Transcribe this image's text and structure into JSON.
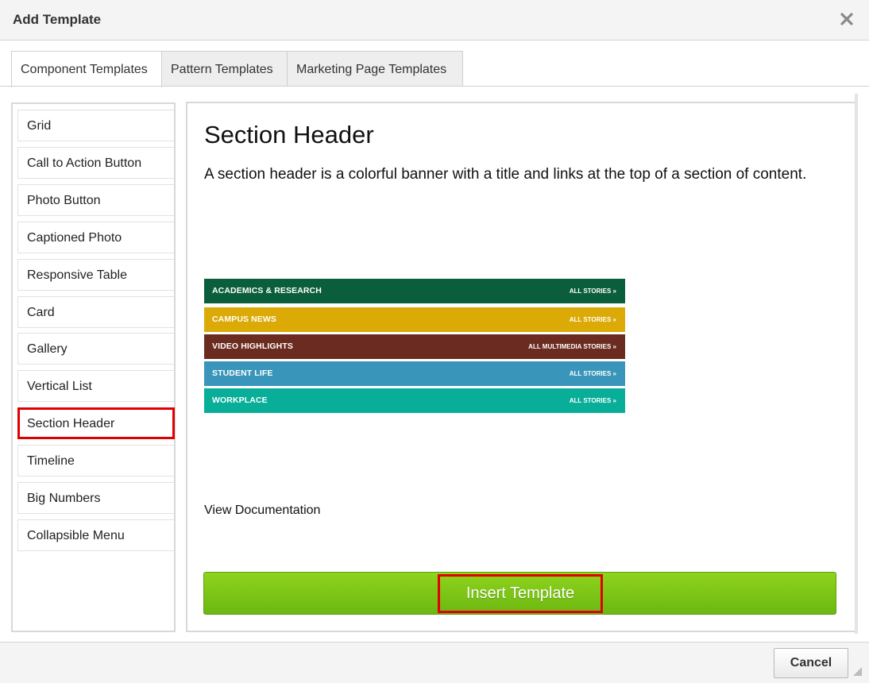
{
  "dialog": {
    "title": "Add Template",
    "close_icon": "close-icon"
  },
  "tabs": [
    {
      "label": "Component Templates",
      "active": true
    },
    {
      "label": "Pattern Templates",
      "active": false
    },
    {
      "label": "Marketing Page Templates",
      "active": false
    }
  ],
  "sidebar": {
    "selected": "Section Header",
    "items": [
      {
        "label": "Grid"
      },
      {
        "label": "Call to Action Button"
      },
      {
        "label": "Photo Button"
      },
      {
        "label": "Captioned Photo"
      },
      {
        "label": "Responsive Table"
      },
      {
        "label": "Card"
      },
      {
        "label": "Gallery"
      },
      {
        "label": "Vertical List"
      },
      {
        "label": "Section Header"
      },
      {
        "label": "Timeline"
      },
      {
        "label": "Big Numbers"
      },
      {
        "label": "Collapsible Menu"
      }
    ]
  },
  "main": {
    "title": "Section Header",
    "description": "A section header is a colorful banner with a title and links at the top of a section of content.",
    "preview_banners": [
      {
        "title": "ACADEMICS & RESEARCH",
        "link": "ALL STORIES »",
        "color": "#0b5e3c"
      },
      {
        "title": "CAMPUS NEWS",
        "link": "ALL STORIES »",
        "color": "#dcaa06"
      },
      {
        "title": "VIDEO HIGHLIGHTS",
        "link": "ALL MULTIMEDIA STORIES »",
        "color": "#6b2b20"
      },
      {
        "title": "STUDENT LIFE",
        "link": "ALL STORIES »",
        "color": "#3a95ba"
      },
      {
        "title": "WORKPLACE",
        "link": "ALL STORIES »",
        "color": "#08ae98"
      }
    ],
    "documentation_link": "View Documentation",
    "insert_label": "Insert Template"
  },
  "footer": {
    "cancel_label": "Cancel"
  },
  "colors": {
    "highlight": "#e10000",
    "insert_green": "#7cc516"
  }
}
